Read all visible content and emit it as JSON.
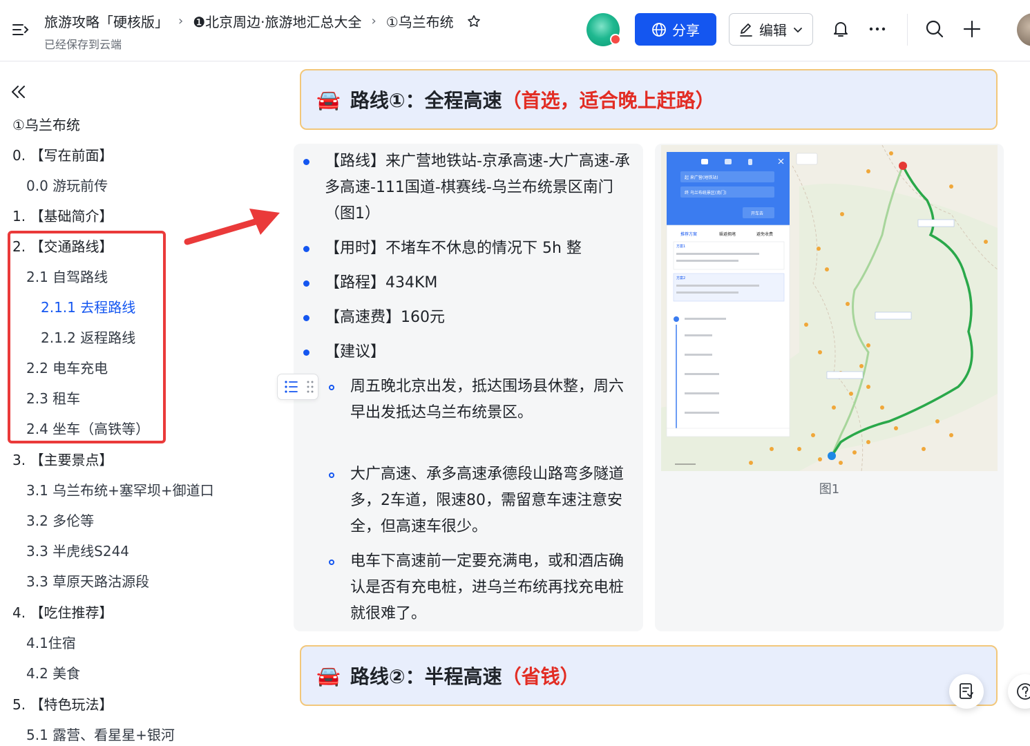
{
  "header": {
    "breadcrumb": [
      "旅游攻略「硬核版」",
      "❶北京周边·旅游地汇总大全",
      "①乌兰布统"
    ],
    "saved_status": "已经保存到云端",
    "share_label": "分享",
    "edit_label": "编辑"
  },
  "sidebar": {
    "items": [
      {
        "label": "①乌兰布统"
      },
      {
        "label": "0. 【写在前面】"
      },
      {
        "label": "0.0 游玩前传"
      },
      {
        "label": "1. 【基础简介】"
      },
      {
        "label": "2. 【交通路线】"
      },
      {
        "label": "2.1 自驾路线"
      },
      {
        "label": "2.1.1 去程路线"
      },
      {
        "label": "2.1.2 返程路线"
      },
      {
        "label": "2.2 电车充电"
      },
      {
        "label": "2.3 租车"
      },
      {
        "label": "2.4 坐车（高铁等）"
      },
      {
        "label": "3. 【主要景点】"
      },
      {
        "label": "3.1 乌兰布统+塞罕坝+御道口"
      },
      {
        "label": "3.2 多伦等"
      },
      {
        "label": "3.3 半虎线S244"
      },
      {
        "label": "3.3 草原天路沽源段"
      },
      {
        "label": "4. 【吃住推荐】"
      },
      {
        "label": "4.1住宿"
      },
      {
        "label": "4.2 美食"
      },
      {
        "label": "5. 【特色玩法】"
      },
      {
        "label": "5.1 露营、看星星+银河"
      }
    ]
  },
  "content": {
    "route1": {
      "emoji": "🚘",
      "title": "路线①：全程高速",
      "note": "（首选，适合晚上赶路）"
    },
    "bullets": [
      "【路线】来广营地铁站-京承高速-大广高速-承多高速-111国道-棋赛线-乌兰布统景区南门（图1）",
      "【用时】不堵车不休息的情况下 5h 整",
      "【路程】434KM",
      "【高速费】160元",
      "【建议】"
    ],
    "sub_bullets": [
      "周五晚北京出发，抵达围场县休整，周六早出发抵达乌兰布统景区。",
      "大广高速、承多高速承德段山路弯多隧道多，2车道，限速80，需留意车速注意安全，但高速车很少。",
      "电车下高速前一定要充满电，或和酒店确认是否有充电桩，进乌兰布统再找充电桩就很难了。"
    ],
    "figure_caption": "图1",
    "route2": {
      "emoji": "🚘",
      "title": "路线②：半程高速",
      "note": "（省钱）"
    }
  },
  "map": {
    "from": "起 来广营(地铁站)",
    "to": "终 乌兰布统景区(南门)",
    "button": "开车去",
    "tabs": [
      "推荐方案",
      "躲避拥堵",
      "避免收费"
    ],
    "plan1_label": "方案1",
    "plan2_label": "方案2"
  },
  "colors": {
    "accent": "#1456f0",
    "highlight_red": "#e22d24",
    "annotation_red": "#ea3a3a",
    "callout_bg": "#e8eefc",
    "callout_border": "#f2c77a"
  }
}
